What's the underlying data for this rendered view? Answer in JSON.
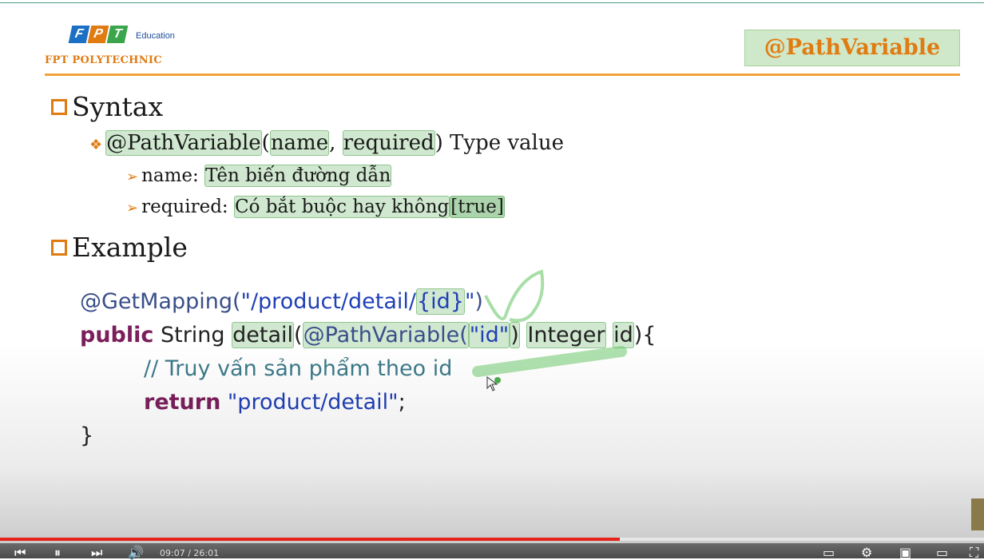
{
  "header": {
    "logo_letters": [
      "F",
      "P",
      "T"
    ],
    "logo_edu": "Education",
    "school": "FPT POLYTECHNIC",
    "title": "@PathVariable"
  },
  "syntax": {
    "heading": "Syntax",
    "signature_annotation": "@PathVariable",
    "signature_open": "(",
    "param_name": "name",
    "comma": ",",
    "param_required": "required",
    "signature_close": ") Type value",
    "name_label": "name:",
    "name_desc": "Tên biến đường dẫn",
    "required_label": "required:",
    "required_desc": "Có bắt buộc hay không",
    "required_default": "[true]"
  },
  "example": {
    "heading": "Example",
    "line1_ann": "@GetMapping(",
    "line1_str_a": "\"/product/detail/",
    "line1_str_b": "{id}",
    "line1_str_c": "\"",
    "line1_close": ")",
    "line2_kw": "public",
    "line2_type": " String ",
    "line2_method": "detail",
    "line2_paren": "(",
    "line2_ann": "@PathVariable(",
    "line2_str": "\"id\"",
    "line2_paren2": ")",
    "line2_type2": "Integer",
    "line2_param": "id",
    "line2_end": "){",
    "line3_comment": "// Truy vấn sản phẩm theo id",
    "line4_kw": "return",
    "line4_str": "\"product/detail\"",
    "line4_end": ";",
    "line5": "}"
  },
  "player": {
    "progress": 0.63,
    "time": "09:07 / 26:01"
  },
  "colors": {
    "accent_orange": "#e07b12",
    "highlight_green": "#cfe8c9",
    "keyword": "#7b1f5c",
    "string": "#1f3fb5",
    "progress_red": "#e5231b"
  }
}
